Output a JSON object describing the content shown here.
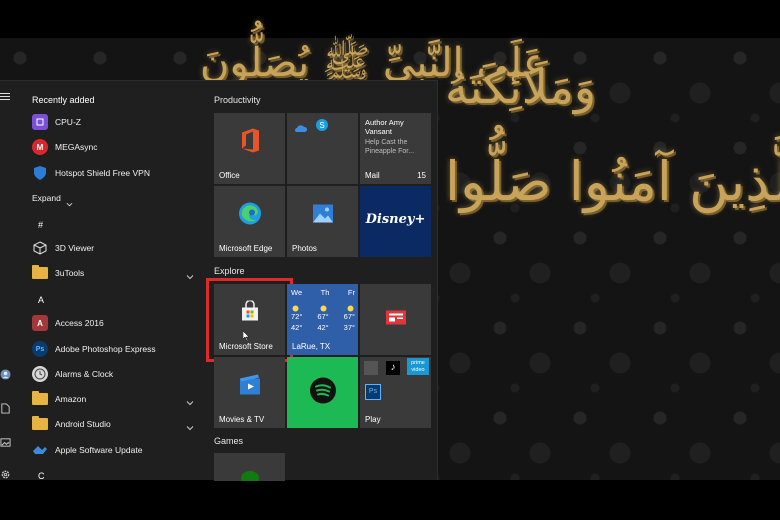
{
  "start_menu": {
    "recently_added_label": "Recently added",
    "recent_apps": [
      {
        "label": "CPU-Z",
        "icon": "cpuz-icon",
        "color": "#7b4fd6"
      },
      {
        "label": "MEGAsync",
        "icon": "mega-icon",
        "color": "#d9272e"
      },
      {
        "label": "Hotspot Shield Free VPN",
        "icon": "shield-icon",
        "color": "#2b7cd3"
      }
    ],
    "expand_label": "Expand",
    "hash_label": "#",
    "viewer_label": "3D Viewer",
    "tools_label": "3uTools",
    "a_label": "A",
    "access_label": "Access 2016",
    "photoshop_label": "Adobe Photoshop Express",
    "alarms_label": "Alarms & Clock",
    "amazon_label": "Amazon",
    "android_label": "Android Studio",
    "apple_label": "Apple Software Update",
    "c_label": "C"
  },
  "tiles": {
    "productivity_label": "Productivity",
    "explore_label": "Explore",
    "games_label": "Games",
    "office_label": "Office",
    "mail_author": "Author Amy Vansant",
    "mail_preview": "Help Cast the Pineapple For...",
    "mail_label": "Mail",
    "mail_count": "15",
    "edge_label": "Microsoft Edge",
    "photos_label": "Photos",
    "disney_label": "Disney+",
    "store_label": "Microsoft Store",
    "weather_days": [
      "We",
      "Th",
      "Fr"
    ],
    "weather_highs": [
      "72°",
      "67°",
      "67°"
    ],
    "weather_lows": [
      "42°",
      "42°",
      "37°"
    ],
    "weather_location": "LaRue, TX",
    "movies_label": "Movies & TV",
    "play_label": "Play",
    "prime_label": "prime video"
  },
  "colors": {
    "highlight": "#e02a2a",
    "disney_bg": "#0b2a63",
    "weather_bg": "#2f5fa8",
    "spotify_bg": "#1db954",
    "accent_blue": "#2b7cd3"
  }
}
